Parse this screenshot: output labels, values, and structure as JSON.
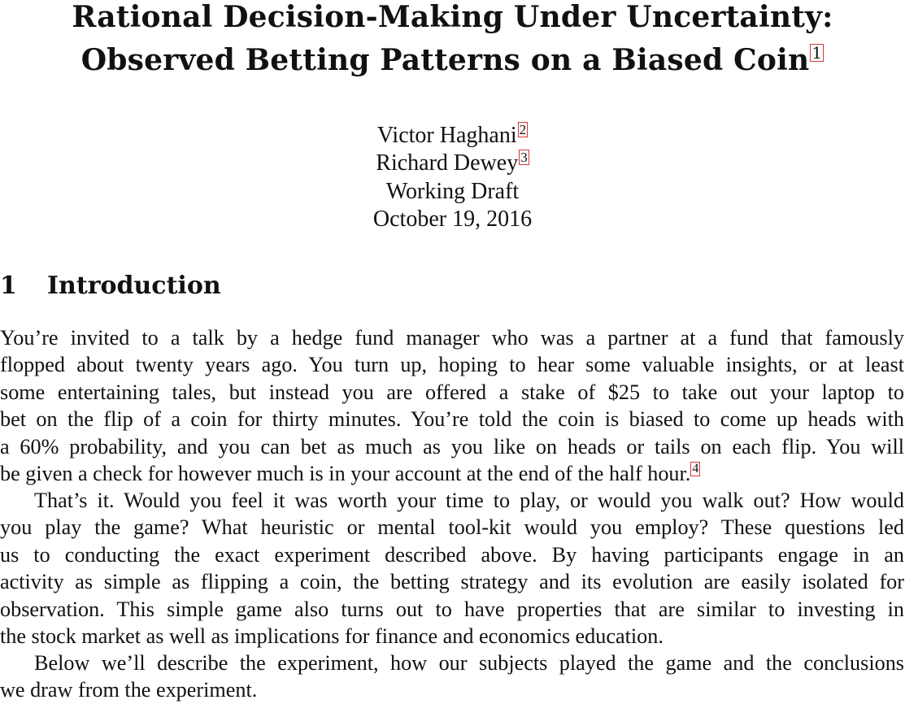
{
  "title": {
    "line1": "Rational Decision-Making Under Uncertainty:",
    "line2": "Observed Betting Patterns on a Biased Coin",
    "footnote": "1"
  },
  "authors": [
    {
      "name": "Victor Haghani",
      "footnote": "2"
    },
    {
      "name": "Richard Dewey",
      "footnote": "3"
    }
  ],
  "status": "Working Draft",
  "date": "October 19, 2016",
  "section": {
    "number": "1",
    "title": "Introduction"
  },
  "paragraphs": {
    "p1": [
      "You’re invited to a talk by a hedge fund manager who was a partner at a fund that famously",
      "flopped about twenty years ago. You turn up, hoping to hear some valuable insights, or at least",
      "some entertaining tales, but instead you are offered a stake of $25 to take out your laptop to",
      "bet on the flip of a coin for thirty minutes. You’re told the coin is biased to come up heads with",
      "a 60% probability, and you can bet as much as you like on heads or tails on each flip. You will",
      "be given a check for however much is in your account at the end of the half hour."
    ],
    "p1_footnote": "4",
    "p2": [
      "That’s it. Would you feel it was worth your time to play, or would you walk out? How would",
      "you play the game? What heuristic or mental tool-kit would you employ? These questions led",
      "us to conducting the exact experiment described above. By having participants engage in an",
      "activity as simple as flipping a coin, the betting strategy and its evolution are easily isolated for",
      "observation. This simple game also turns out to have properties that are similar to investing in",
      "the stock market as well as implications for finance and economics education."
    ],
    "p3": [
      "Below we’ll describe the experiment, how our subjects played the game and the conclusions",
      "we draw from the experiment."
    ]
  }
}
